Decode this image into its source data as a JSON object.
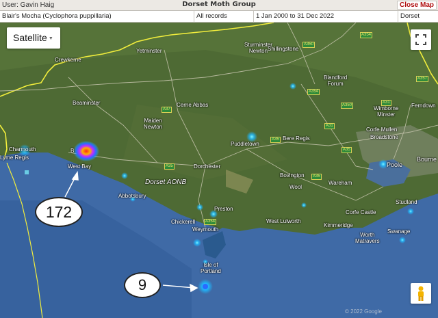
{
  "header": {
    "user": "User: Gavin Haig",
    "group": "Dorset Moth Group",
    "close_label": "Close Map"
  },
  "filters": {
    "species": "Blair's Mocha (Cyclophora puppillaria)",
    "records": "All records",
    "date_range": "1 Jan 2000 to 31 Dec 2022",
    "county": "Dorset"
  },
  "controls": {
    "map_type": "Satellite",
    "caret": "▼",
    "fullscreen_icon": "fullscreen-icon",
    "pegman_icon": "pegman-icon"
  },
  "places": {
    "sturminster": "Sturminster\nNewton",
    "shillingstone": "Shillingstone",
    "yetminster": "Yetminster",
    "crewkerne": "Crewkerne",
    "blandford": "Blandford\nForum",
    "wimborne": "Wimborne\nMinster",
    "ferndown": "Ferndown",
    "beaminster": "Beaminster",
    "cerne": "Cerne Abbas",
    "maiden": "Maiden\nNewton",
    "corfe_mullen": "Corfe Mullen",
    "broadstone": "Broadstone",
    "puddletown": "Puddletown",
    "bere_regis": "Bere Regis",
    "charmouth": "Charmouth",
    "lyme": "Lyme Regis",
    "bridport_frag": "B",
    "west_bay": "West Bay",
    "dorchester": "Dorchester",
    "poole": "Poole",
    "bournemouth_frag": "Bourne",
    "aonb": "Dorset AONB",
    "bovington": "Bovington",
    "wool": "Wool",
    "wareham": "Wareham",
    "abbotsbury": "Abbotsbury",
    "preston": "Preston",
    "chickerell": "Chickerell",
    "weymouth": "Weymouth",
    "west_lulworth": "West Lulworth",
    "kimmeridge": "Kimmeridge",
    "corfe_castle": "Corfe Castle",
    "studland": "Studland",
    "swanage": "Swanage",
    "worth_matravers": "Worth\nMatravers",
    "portland": "Isle of\nPortland"
  },
  "roads": [
    "A354",
    "A350",
    "A357",
    "A354",
    "A37",
    "A350",
    "A31",
    "A35",
    "A35",
    "A35",
    "A31",
    "A354",
    "A35"
  ],
  "heat_spots": [
    {
      "place": "West Bay",
      "count": 172,
      "intensity": "high"
    },
    {
      "place": "Isle of Portland",
      "count": 9,
      "intensity": "medium"
    }
  ],
  "annotations": {
    "west_bay_count": "172",
    "portland_count": "9"
  },
  "copyright": "© 2022 Google",
  "colors": {
    "land": "#4e6a34",
    "sea": "#3f6aa6",
    "boundary": "#f2ee3c",
    "heat_hot": "#ff2a18",
    "heat_cool": "#1fb8ff",
    "close_text": "#b01010"
  }
}
